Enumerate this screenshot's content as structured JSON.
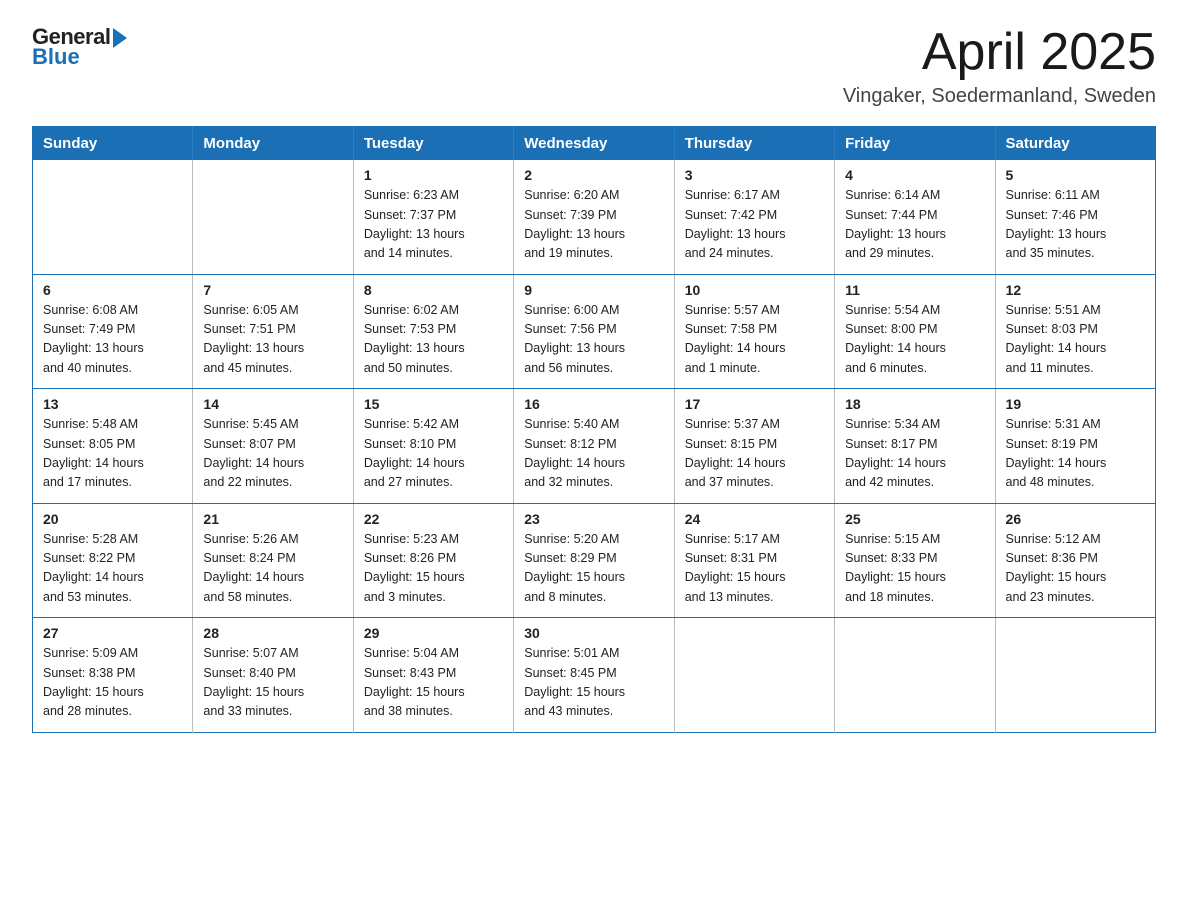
{
  "logo": {
    "general": "General",
    "blue": "Blue"
  },
  "header": {
    "month": "April 2025",
    "location": "Vingaker, Soedermanland, Sweden"
  },
  "weekdays": [
    "Sunday",
    "Monday",
    "Tuesday",
    "Wednesday",
    "Thursday",
    "Friday",
    "Saturday"
  ],
  "weeks": [
    [
      {
        "day": "",
        "info": ""
      },
      {
        "day": "",
        "info": ""
      },
      {
        "day": "1",
        "info": "Sunrise: 6:23 AM\nSunset: 7:37 PM\nDaylight: 13 hours\nand 14 minutes."
      },
      {
        "day": "2",
        "info": "Sunrise: 6:20 AM\nSunset: 7:39 PM\nDaylight: 13 hours\nand 19 minutes."
      },
      {
        "day": "3",
        "info": "Sunrise: 6:17 AM\nSunset: 7:42 PM\nDaylight: 13 hours\nand 24 minutes."
      },
      {
        "day": "4",
        "info": "Sunrise: 6:14 AM\nSunset: 7:44 PM\nDaylight: 13 hours\nand 29 minutes."
      },
      {
        "day": "5",
        "info": "Sunrise: 6:11 AM\nSunset: 7:46 PM\nDaylight: 13 hours\nand 35 minutes."
      }
    ],
    [
      {
        "day": "6",
        "info": "Sunrise: 6:08 AM\nSunset: 7:49 PM\nDaylight: 13 hours\nand 40 minutes."
      },
      {
        "day": "7",
        "info": "Sunrise: 6:05 AM\nSunset: 7:51 PM\nDaylight: 13 hours\nand 45 minutes."
      },
      {
        "day": "8",
        "info": "Sunrise: 6:02 AM\nSunset: 7:53 PM\nDaylight: 13 hours\nand 50 minutes."
      },
      {
        "day": "9",
        "info": "Sunrise: 6:00 AM\nSunset: 7:56 PM\nDaylight: 13 hours\nand 56 minutes."
      },
      {
        "day": "10",
        "info": "Sunrise: 5:57 AM\nSunset: 7:58 PM\nDaylight: 14 hours\nand 1 minute."
      },
      {
        "day": "11",
        "info": "Sunrise: 5:54 AM\nSunset: 8:00 PM\nDaylight: 14 hours\nand 6 minutes."
      },
      {
        "day": "12",
        "info": "Sunrise: 5:51 AM\nSunset: 8:03 PM\nDaylight: 14 hours\nand 11 minutes."
      }
    ],
    [
      {
        "day": "13",
        "info": "Sunrise: 5:48 AM\nSunset: 8:05 PM\nDaylight: 14 hours\nand 17 minutes."
      },
      {
        "day": "14",
        "info": "Sunrise: 5:45 AM\nSunset: 8:07 PM\nDaylight: 14 hours\nand 22 minutes."
      },
      {
        "day": "15",
        "info": "Sunrise: 5:42 AM\nSunset: 8:10 PM\nDaylight: 14 hours\nand 27 minutes."
      },
      {
        "day": "16",
        "info": "Sunrise: 5:40 AM\nSunset: 8:12 PM\nDaylight: 14 hours\nand 32 minutes."
      },
      {
        "day": "17",
        "info": "Sunrise: 5:37 AM\nSunset: 8:15 PM\nDaylight: 14 hours\nand 37 minutes."
      },
      {
        "day": "18",
        "info": "Sunrise: 5:34 AM\nSunset: 8:17 PM\nDaylight: 14 hours\nand 42 minutes."
      },
      {
        "day": "19",
        "info": "Sunrise: 5:31 AM\nSunset: 8:19 PM\nDaylight: 14 hours\nand 48 minutes."
      }
    ],
    [
      {
        "day": "20",
        "info": "Sunrise: 5:28 AM\nSunset: 8:22 PM\nDaylight: 14 hours\nand 53 minutes."
      },
      {
        "day": "21",
        "info": "Sunrise: 5:26 AM\nSunset: 8:24 PM\nDaylight: 14 hours\nand 58 minutes."
      },
      {
        "day": "22",
        "info": "Sunrise: 5:23 AM\nSunset: 8:26 PM\nDaylight: 15 hours\nand 3 minutes."
      },
      {
        "day": "23",
        "info": "Sunrise: 5:20 AM\nSunset: 8:29 PM\nDaylight: 15 hours\nand 8 minutes."
      },
      {
        "day": "24",
        "info": "Sunrise: 5:17 AM\nSunset: 8:31 PM\nDaylight: 15 hours\nand 13 minutes."
      },
      {
        "day": "25",
        "info": "Sunrise: 5:15 AM\nSunset: 8:33 PM\nDaylight: 15 hours\nand 18 minutes."
      },
      {
        "day": "26",
        "info": "Sunrise: 5:12 AM\nSunset: 8:36 PM\nDaylight: 15 hours\nand 23 minutes."
      }
    ],
    [
      {
        "day": "27",
        "info": "Sunrise: 5:09 AM\nSunset: 8:38 PM\nDaylight: 15 hours\nand 28 minutes."
      },
      {
        "day": "28",
        "info": "Sunrise: 5:07 AM\nSunset: 8:40 PM\nDaylight: 15 hours\nand 33 minutes."
      },
      {
        "day": "29",
        "info": "Sunrise: 5:04 AM\nSunset: 8:43 PM\nDaylight: 15 hours\nand 38 minutes."
      },
      {
        "day": "30",
        "info": "Sunrise: 5:01 AM\nSunset: 8:45 PM\nDaylight: 15 hours\nand 43 minutes."
      },
      {
        "day": "",
        "info": ""
      },
      {
        "day": "",
        "info": ""
      },
      {
        "day": "",
        "info": ""
      }
    ]
  ]
}
